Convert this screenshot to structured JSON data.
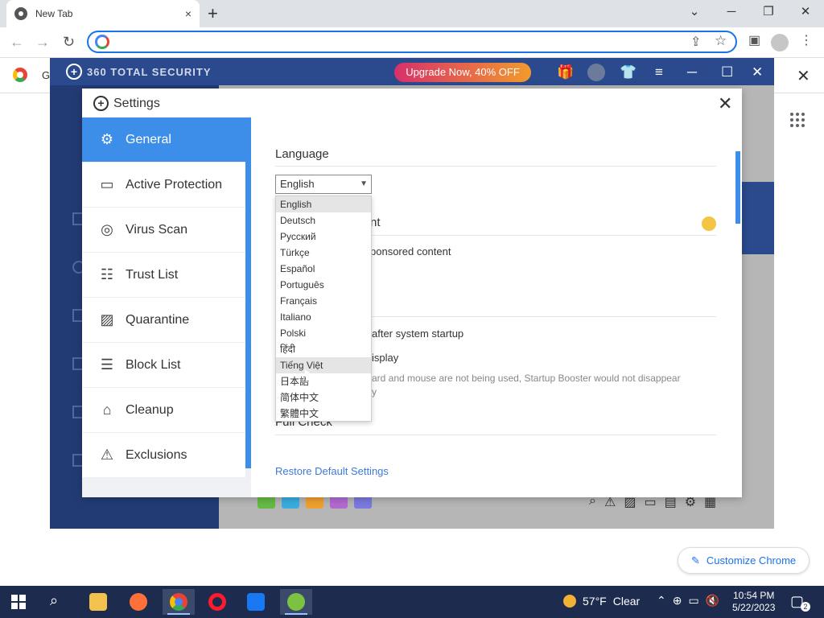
{
  "browser": {
    "tab_title": "New Tab",
    "tab_close": "×",
    "new_tab": "+",
    "win_min": "─",
    "win_restore": "❐",
    "win_close": "✕",
    "back": "←",
    "forward": "→",
    "reload": "↻",
    "omnibox_value": "",
    "bookmark_partial": "G",
    "newtab_close": "✕",
    "customize_label": "Customize Chrome"
  },
  "app360": {
    "brand": "360 TOTAL SECURITY",
    "upgrade_label": "Upgrade Now, 40% OFF"
  },
  "settings": {
    "title": "Settings",
    "sidebar": [
      {
        "label": "General",
        "icon": "gear-icon"
      },
      {
        "label": "Active Protection",
        "icon": "shield-monitor-icon"
      },
      {
        "label": "Virus Scan",
        "icon": "scan-icon"
      },
      {
        "label": "Trust List",
        "icon": "trust-list-icon"
      },
      {
        "label": "Quarantine",
        "icon": "quarantine-icon"
      },
      {
        "label": "Block List",
        "icon": "block-list-icon"
      },
      {
        "label": "Cleanup",
        "icon": "cleanup-icon"
      },
      {
        "label": "Exclusions",
        "icon": "exclusions-icon"
      }
    ],
    "language_heading": "Language",
    "language_selected": "English",
    "sponsored_heading_tail": "nt",
    "sponsored_text_tail": "ponsored content",
    "startup_text_tail": "after system startup",
    "display_text_tail": "isplay",
    "booster_note_tail": "ard and mouse are not being used, Startup Booster would not disappear",
    "booster_note_tail2": "y",
    "full_check_heading": "Full Check",
    "restore_link": "Restore Default Settings",
    "language_options": [
      "English",
      "Deutsch",
      "Русский",
      "Türkçe",
      "Español",
      "Português",
      "Français",
      "Italiano",
      "Polski",
      "हिंदी",
      "Tiếng Việt",
      "日本語",
      "简体中文",
      "繁體中文"
    ]
  },
  "taskbar": {
    "temperature": "57°F",
    "condition": "Clear",
    "time": "10:54 PM",
    "date": "5/22/2023",
    "notifications": "2"
  }
}
